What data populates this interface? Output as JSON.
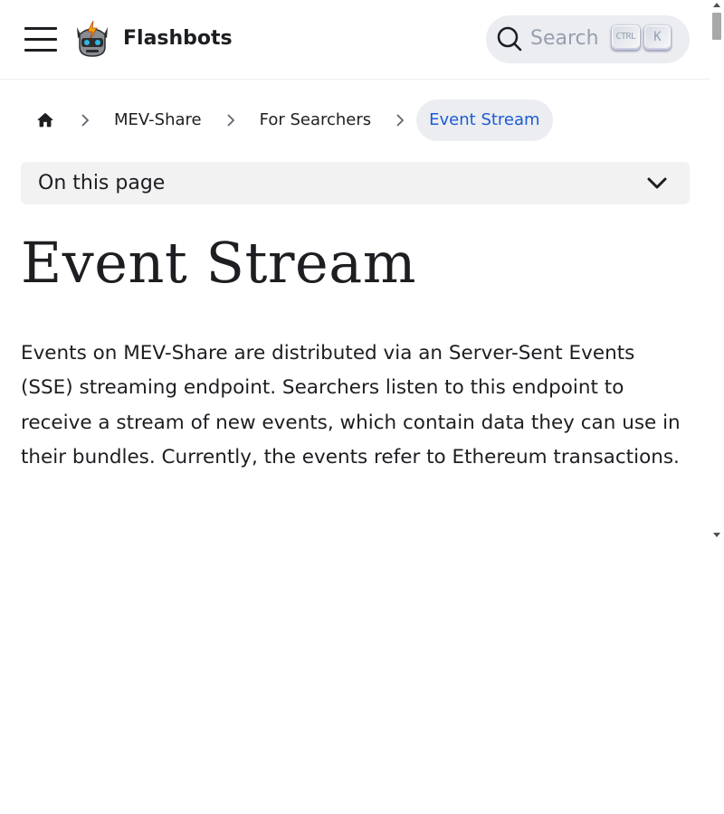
{
  "navbar": {
    "brand": "Flashbots",
    "search_placeholder": "Search",
    "shortcut_keys": [
      "CTRL",
      "K"
    ]
  },
  "breadcrumbs": {
    "items": [
      {
        "label": "MEV-Share"
      },
      {
        "label": "For Searchers"
      },
      {
        "label": "Event Stream",
        "active": true
      }
    ]
  },
  "toc": {
    "label": "On this page"
  },
  "page": {
    "title": "Event Stream",
    "intro": "Events on MEV-Share are distributed via an Server-Sent Events (SSE) streaming endpoint. Searchers listen to this endpoint to receive a stream of new events, which contain data they can use in their bundles. Currently, the events refer to Ethereum transactions."
  },
  "colors": {
    "text": "#1c1e21",
    "link_active": "#1c5bd6",
    "search_bg": "#ebedf0",
    "toc_bg": "#f2f2f3"
  }
}
